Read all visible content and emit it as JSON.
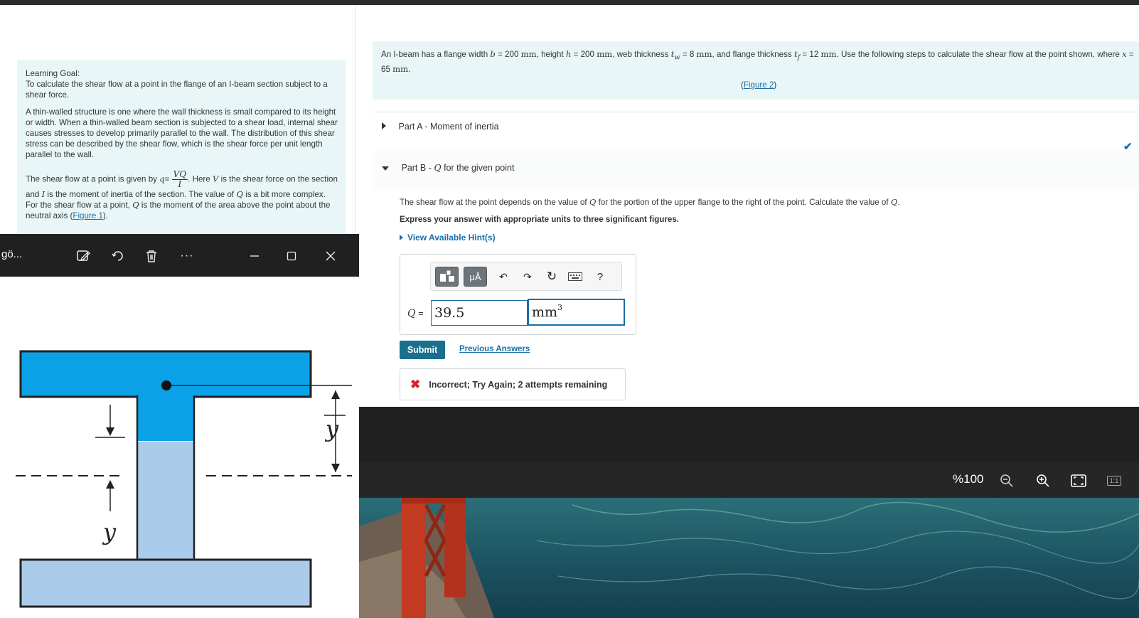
{
  "learning_goal": {
    "heading": "Learning Goal:",
    "goal_text": "To calculate the shear flow at a point in the flange of an I-beam section subject to a shear force.",
    "para1": "A thin-walled structure is one where the wall thickness is small compared to its height or width. When a thin-walled beam section is subjected to a shear load, internal shear causes stresses to develop primarily parallel to the wall. The distribution of this shear stress can be described by the shear flow, which is the shear force per unit length parallel to the wall.",
    "para2_a": "The shear flow at a point is given by",
    "para2_q": "q",
    "para2_eq": "=",
    "frac_num": "VQ",
    "frac_den": "I",
    "para2_b": ". Here",
    "var_v": "V",
    "para2_c": "is the shear force on the section and",
    "var_i": "I",
    "para2_d": "is the moment of inertia of the section. The value of",
    "var_q1": "Q",
    "para2_e": "is a bit more complex. For the shear flow at a point,",
    "var_q2": "Q",
    "para2_f": "is the moment of the area above the point about the neutral axis (",
    "figure_link": "Figure 1",
    "para2_g": ")."
  },
  "problem": {
    "t1": "An I-beam has a flange width",
    "b": "b",
    "t2": "= 200",
    "u1": "mm",
    "t3": ", height",
    "h": "h",
    "t4": "= 200",
    "u2": "mm",
    "t5": ", web thickness",
    "tw": "t",
    "tw_sub": "w",
    "t6": "= 8",
    "u3": "mm",
    "t7": ", and flange thickness",
    "tf": "t",
    "tf_sub": "f",
    "t8": "= 12",
    "u4": "mm",
    "t9": ". Use the following steps to calculate the shear flow at the point shown, where",
    "x": "x",
    "t10": "= 65",
    "u5": "mm",
    "t11": ".",
    "figure_link_pre": "(",
    "figure_link": "Figure 2",
    "figure_link_post": ")"
  },
  "part_a": {
    "label": "Part A",
    "sep": " - ",
    "title": "Moment of inertia"
  },
  "part_b": {
    "label": "Part B",
    "sep": " - ",
    "var": "Q",
    "title": " for the given point"
  },
  "part_b_body": {
    "t1": "The shear flow at the point depends on the value of",
    "v1": "Q",
    "t2": "for the portion of the upper flange to the right of the point. Calculate the value of",
    "v2": "Q",
    "t3": ".",
    "instruction": "Express your answer with appropriate units to three significant figures.",
    "hints": "View Available Hint(s)"
  },
  "answer": {
    "toolbar_units": "μÅ",
    "help": "?",
    "q_label": "Q",
    "q_eq": " =",
    "value": "39.5",
    "unit": "mm",
    "unit_exp": "3"
  },
  "submit_label": "Submit",
  "previous_answers": "Previous Answers",
  "feedback": "Incorrect; Try Again; 2 attempts remaining",
  "viewer": {
    "window_title": "gö...",
    "more": "···",
    "zoom_level": "%100",
    "actual_size": "1:1"
  },
  "figure": {
    "label_y_right": "y",
    "label_y_left": "y"
  }
}
